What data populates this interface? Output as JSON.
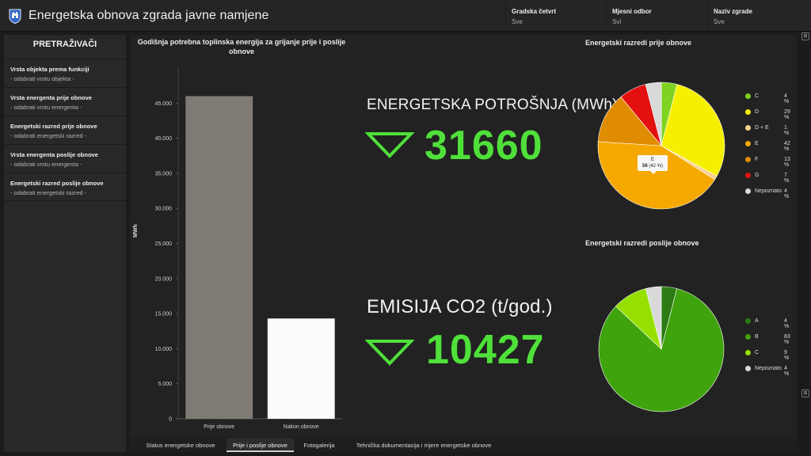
{
  "header": {
    "title": "Energetska obnova zgrada javne namjene",
    "filters": [
      {
        "label": "Gradska četvrt",
        "value": "Sve"
      },
      {
        "label": "Mjesni odbor",
        "value": "Svi"
      },
      {
        "label": "Naziv zgrade",
        "value": "Sve"
      }
    ]
  },
  "sidebar": {
    "title": "PRETRAŽIVAČI",
    "items": [
      {
        "label": "Vrsta objekta prema funkciji",
        "placeholder": "- odabrati vrstu objekta -"
      },
      {
        "label": "Vrsta energenta prije obnove",
        "placeholder": "- odabrati vrstu energenta -"
      },
      {
        "label": "Energetski razred prije obnove",
        "placeholder": "- odabrati energetski razred -"
      },
      {
        "label": "Vrsta energenta poslije obnove",
        "placeholder": "- odabrati vrstu energenta -"
      },
      {
        "label": "Energetski razred poslije obnove",
        "placeholder": "- odabrati energetski razred -"
      }
    ]
  },
  "kpi": {
    "energy_label": "ENERGETSKA POTROŠNJA (MWh)",
    "energy_value": "31660",
    "co2_label": "EMISIJA CO2 (t/god.)",
    "co2_value": "10427",
    "arrow_color": "#4fe03a"
  },
  "tooltip": {
    "category": "E",
    "value": "56",
    "percent": "(42 %)"
  },
  "chart_data": [
    {
      "type": "bar",
      "title": "Godišnja potrebna toplinska energija za grijanje prije i poslije obnove",
      "ylabel": "MWh",
      "categories": [
        "Prije obnove",
        "Nakon obnove"
      ],
      "values": [
        46000,
        14300
      ],
      "colors": [
        "#7f7b74",
        "#fbfbf9"
      ],
      "ylim": [
        0,
        50000
      ],
      "yticks": [
        0,
        5000,
        10000,
        15000,
        20000,
        25000,
        30000,
        35000,
        40000,
        45000
      ],
      "ytick_labels": [
        "0",
        "5.000",
        "10.000",
        "15.000",
        "20.000",
        "25.000",
        "30.000",
        "35.000",
        "40.000",
        "45.000"
      ]
    },
    {
      "type": "pie",
      "title": "Energetski razredi prije obnove",
      "slices": [
        {
          "name": "C",
          "percent": 4,
          "label": "4 %",
          "color": "#7ed321"
        },
        {
          "name": "D",
          "percent": 29,
          "label": "29 %",
          "color": "#f5f000"
        },
        {
          "name": "D + E",
          "percent": 1,
          "label": "1 %",
          "color": "#f8d090"
        },
        {
          "name": "E",
          "percent": 42,
          "label": "42 %",
          "color": "#f5a800"
        },
        {
          "name": "F",
          "percent": 13,
          "label": "13 %",
          "color": "#e08c00"
        },
        {
          "name": "G",
          "percent": 7,
          "label": "7 %",
          "color": "#e31010"
        },
        {
          "name": "Nepoznato",
          "percent": 4,
          "label": "4 %",
          "color": "#d9d9d9"
        }
      ]
    },
    {
      "type": "pie",
      "title": "Energetski razredi poslije obnove",
      "slices": [
        {
          "name": "A",
          "percent": 4,
          "label": "4 %",
          "color": "#2c7a12"
        },
        {
          "name": "B",
          "percent": 83,
          "label": "83 %",
          "color": "#3fa30d"
        },
        {
          "name": "C",
          "percent": 9,
          "label": "9 %",
          "color": "#95e000"
        },
        {
          "name": "Nepoznato",
          "percent": 4,
          "label": "4 %",
          "color": "#d9d9d9"
        }
      ]
    }
  ],
  "tabs": [
    {
      "label": "Status energetske obnove",
      "active": false
    },
    {
      "label": "Prije i poslije obnove",
      "active": true
    },
    {
      "label": "Fotogalerija",
      "active": false
    },
    {
      "label": "Tehnička dokumentacija i mjere energetske obnove",
      "active": false
    }
  ]
}
